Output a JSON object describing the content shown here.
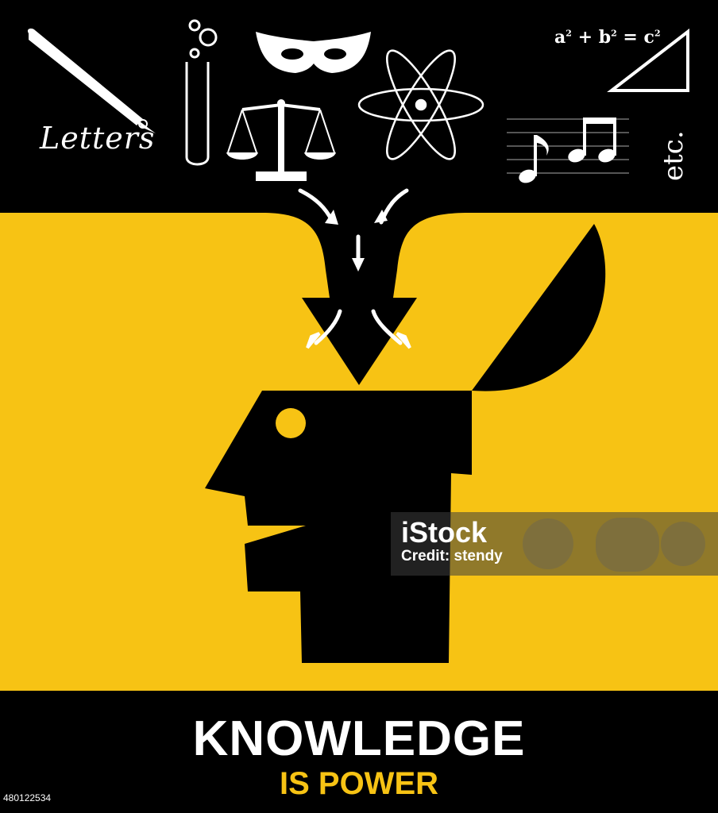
{
  "colors": {
    "background": "#000000",
    "accent_yellow": "#f7c314",
    "icon": "#ffffff"
  },
  "icons": [
    "pen-icon",
    "test-tube-icon",
    "mask-icon",
    "scales-icon",
    "atom-icon",
    "music-notes-icon",
    "triangle-icon"
  ],
  "top_labels": {
    "letters": "Letters",
    "equation": {
      "a": "a",
      "plus": "+",
      "b": "b",
      "equals": "=",
      "c": "c",
      "exp": "2"
    },
    "etc": "etc."
  },
  "watermark": {
    "brand": "iStock",
    "credit": "Credit: stendy"
  },
  "title": "KNOWLEDGE",
  "subtitle": "IS POWER",
  "stock_id": "480122534"
}
